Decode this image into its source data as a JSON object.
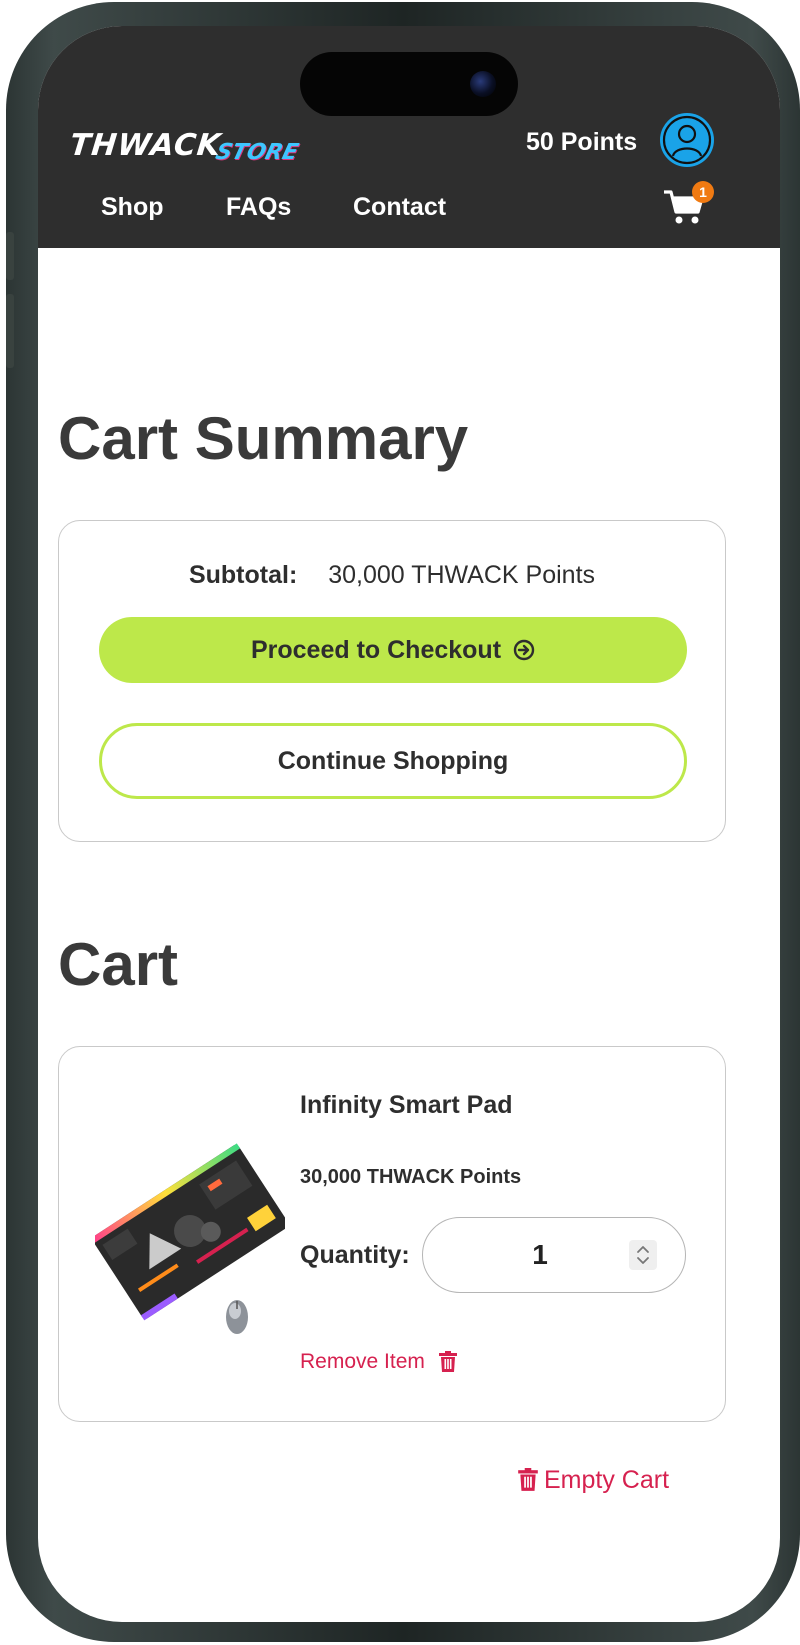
{
  "header": {
    "logo_main": "THWACK",
    "logo_sub": "STORE",
    "points": "50 Points",
    "nav": [
      {
        "label": "Shop"
      },
      {
        "label": "FAQs"
      },
      {
        "label": "Contact"
      }
    ],
    "cart_count": "1"
  },
  "summary": {
    "title": "Cart Summary",
    "subtotal_label": "Subtotal:",
    "subtotal_value": "30,000 THWACK Points",
    "checkout_label": "Proceed to Checkout",
    "continue_label": "Continue Shopping"
  },
  "cart": {
    "title": "Cart",
    "items": [
      {
        "name": "Infinity Smart Pad",
        "price": "30,000 THWACK Points",
        "quantity_label": "Quantity:",
        "quantity": "1",
        "remove_label": "Remove Item"
      }
    ],
    "empty_label": "Empty Cart"
  },
  "colors": {
    "header_bg": "#2e2e2e",
    "accent_green": "#bde84a",
    "danger": "#d6214f",
    "avatar_blue": "#1aa3e8",
    "badge_orange": "#f07a12"
  }
}
